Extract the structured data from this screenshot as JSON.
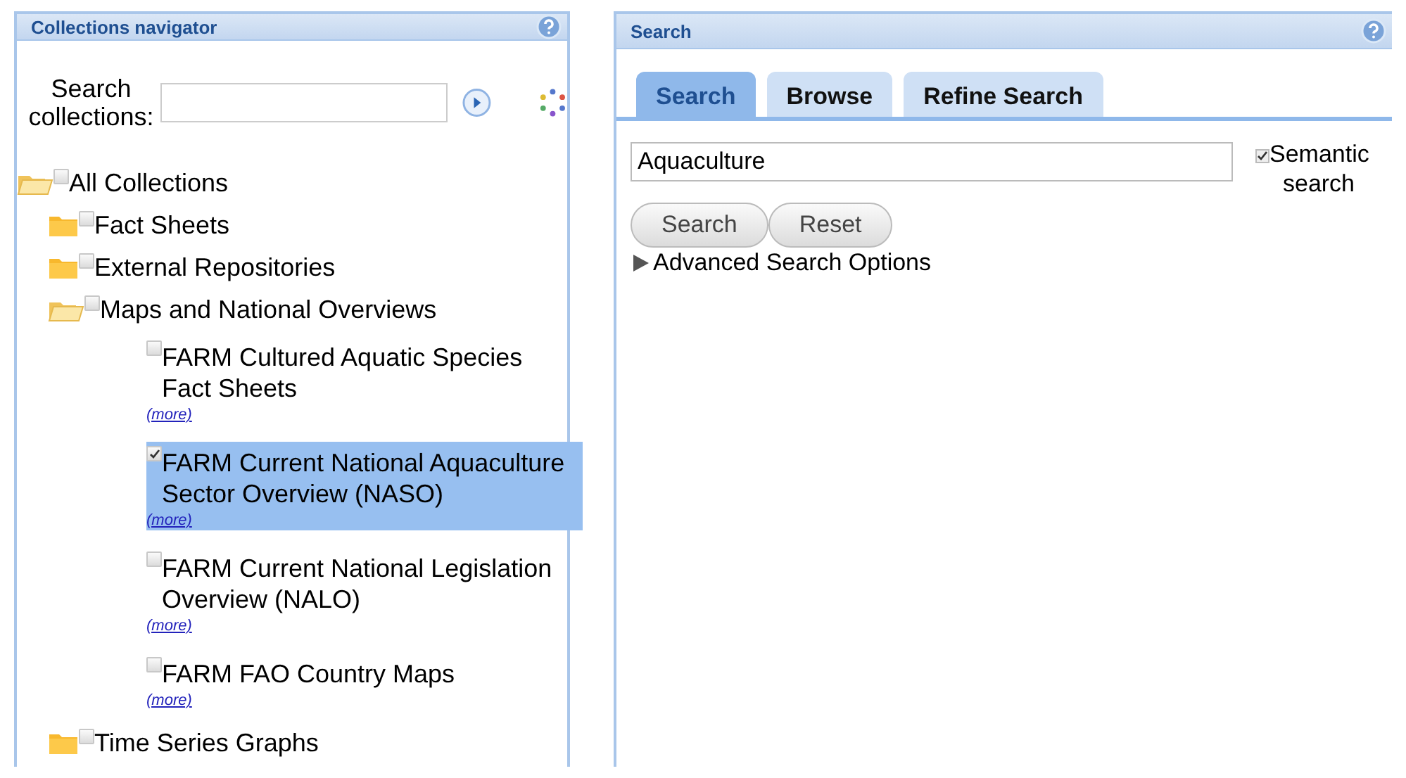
{
  "navigator": {
    "title": "Collections navigator",
    "search_label": "Search collections:",
    "tree": [
      {
        "label": "All Collections",
        "kind": "folder",
        "expanded": true,
        "checked": false,
        "children": [
          {
            "label": "Fact Sheets",
            "kind": "folder",
            "expanded": false,
            "checked": false
          },
          {
            "label": "External Repositories",
            "kind": "folder",
            "expanded": false,
            "checked": false
          },
          {
            "label": "Maps and National Overviews",
            "kind": "folder",
            "expanded": true,
            "checked": false,
            "children": [
              {
                "label": "FARM Cultured Aquatic Species Fact Sheets",
                "kind": "collection",
                "checked": false,
                "selected": false,
                "link": "(more)"
              },
              {
                "label": "FARM Current National Aquaculture Sector Overview (NASO)",
                "kind": "collection",
                "checked": true,
                "selected": true,
                "link": "(more)"
              },
              {
                "label": "FARM Current National Legislation Overview (NALO)",
                "kind": "collection",
                "checked": false,
                "selected": false,
                "link": "(more)"
              },
              {
                "label": "FARM FAO Country Maps",
                "kind": "collection",
                "checked": false,
                "selected": false,
                "link": "(more)"
              }
            ]
          },
          {
            "label": "Time Series Graphs",
            "kind": "folder",
            "expanded": false,
            "checked": false
          }
        ]
      }
    ]
  },
  "search_panel": {
    "title": "Search",
    "tabs": [
      {
        "label": "Search",
        "selected": true
      },
      {
        "label": "Browse",
        "selected": false
      },
      {
        "label": "Refine Search",
        "selected": false
      }
    ],
    "query": {
      "value": "Aquaculture"
    },
    "semantic": {
      "label": "Semantic search",
      "checked": true
    },
    "buttons": [
      "Search",
      "Reset"
    ],
    "advanced": {
      "label": "Advanced Search Options",
      "expanded": false
    }
  }
}
